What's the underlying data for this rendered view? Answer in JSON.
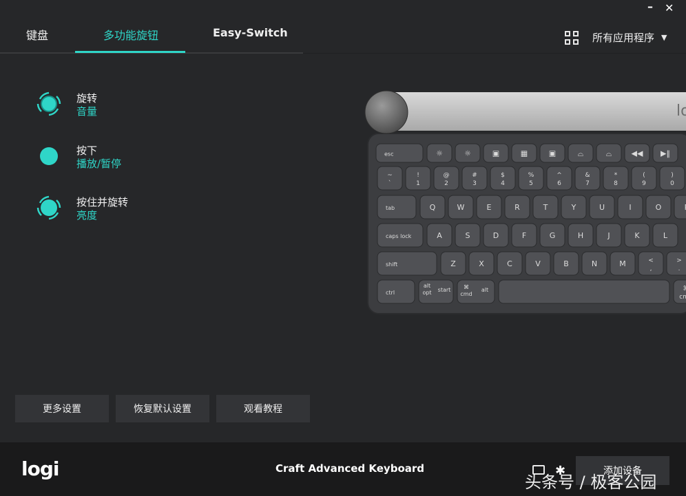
{
  "window": {
    "minimize": "–",
    "close": "✕"
  },
  "tabs": [
    {
      "label": "键盘"
    },
    {
      "label": "多功能旋钮"
    },
    {
      "label": "Easy-Switch"
    }
  ],
  "active_tab": 1,
  "app_selector": {
    "icon": "grid-icon",
    "label": "所有应用程序",
    "chevron": "⌄"
  },
  "actions": [
    {
      "title": "旋转",
      "value": "音量",
      "icon": "rotate-icon"
    },
    {
      "title": "按下",
      "value": "播放/暂停",
      "icon": "press-icon"
    },
    {
      "title": "按住并旋转",
      "value": "亮度",
      "icon": "press-rotate-icon"
    }
  ],
  "buttons": {
    "more_settings": "更多设置",
    "restore_defaults": "恢复默认设置",
    "watch_tutorial": "观看教程"
  },
  "footer": {
    "logo": "logi",
    "device_name": "Craft Advanced Keyboard",
    "add_device": "添加设备",
    "watermark": "头条号 / 极客公园"
  },
  "keyboard": {
    "brand_mark": "lo",
    "row0": [
      "esc",
      "☼",
      "☼",
      "▣",
      "▦",
      "▣",
      "⌓",
      "⌓",
      "◀◀",
      "▶‖"
    ],
    "row1": [
      [
        "~",
        "`"
      ],
      [
        "!",
        "1"
      ],
      [
        "@",
        "2"
      ],
      [
        "#",
        "3"
      ],
      [
        "$",
        "4"
      ],
      [
        "%",
        "5"
      ],
      [
        "^",
        "6"
      ],
      [
        "&",
        "7"
      ],
      [
        "*",
        "8"
      ],
      [
        "(",
        "9"
      ],
      [
        ")",
        "0"
      ]
    ],
    "row2_first": "tab",
    "row2": [
      "Q",
      "W",
      "E",
      "R",
      "T",
      "Y",
      "U",
      "I",
      "O",
      "P"
    ],
    "row3_first": "caps lock",
    "row3": [
      "A",
      "S",
      "D",
      "F",
      "G",
      "H",
      "J",
      "K",
      "L"
    ],
    "row4_first": "shift",
    "row4": [
      "Z",
      "X",
      "C",
      "V",
      "B",
      "N",
      "M"
    ],
    "row4_extra": [
      [
        "<",
        ","
      ],
      [
        ">",
        "."
      ]
    ],
    "row5": {
      "ctrl": "ctrl",
      "alt_opt": [
        "alt",
        "opt"
      ],
      "start": "start",
      "cmd": [
        "⌘",
        "cmd"
      ],
      "alt": "alt",
      "cmd_right": [
        "⌘",
        "cmd"
      ]
    }
  },
  "colors": {
    "accent": "#2fd6c8",
    "background": "#262729",
    "footer": "#1a1a1b",
    "button": "#333437"
  }
}
